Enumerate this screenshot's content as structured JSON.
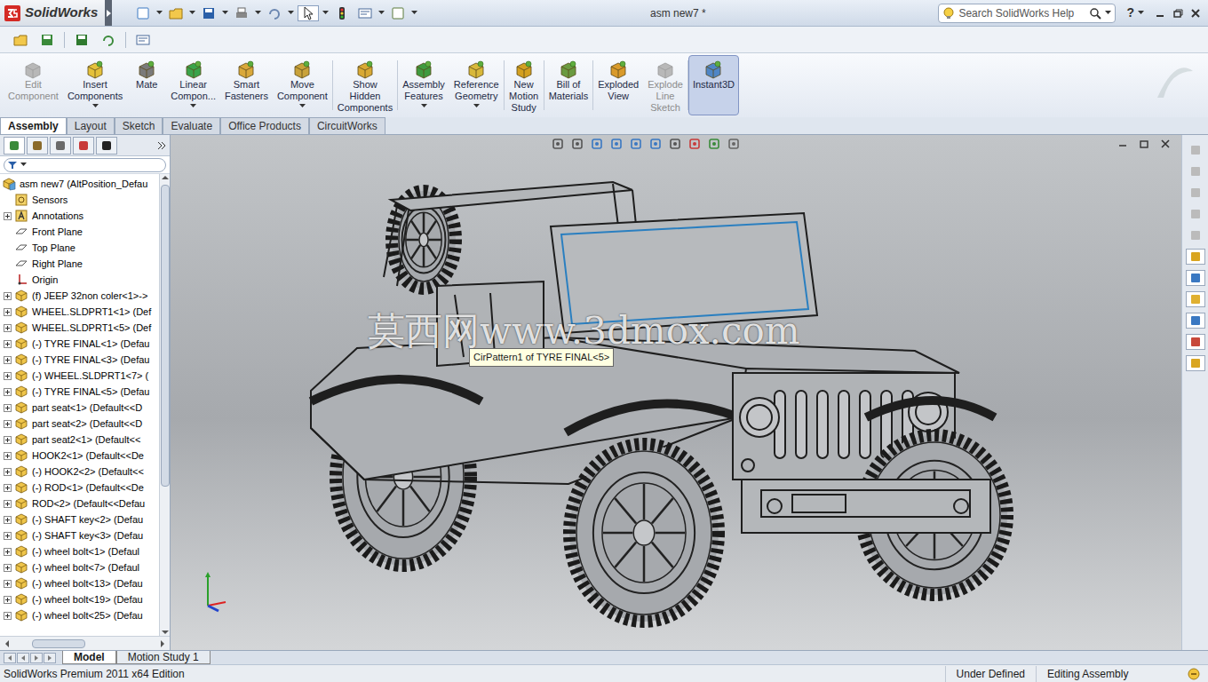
{
  "window": {
    "app_name": "SolidWorks",
    "title": "asm new7 *"
  },
  "search": {
    "placeholder": "Search SolidWorks Help"
  },
  "help": "?",
  "ribbon": [
    {
      "lines": [
        "Edit",
        "Component"
      ],
      "disabled": true,
      "selected": false,
      "dropdown": false,
      "group": 1
    },
    {
      "lines": [
        "Insert",
        "Components"
      ],
      "disabled": false,
      "selected": false,
      "dropdown": true,
      "group": 1
    },
    {
      "lines": [
        "Mate"
      ],
      "disabled": false,
      "selected": false,
      "dropdown": false,
      "group": 1
    },
    {
      "lines": [
        "Linear",
        "Compon..."
      ],
      "disabled": false,
      "selected": false,
      "dropdown": true,
      "group": 1
    },
    {
      "lines": [
        "Smart",
        "Fasteners"
      ],
      "disabled": false,
      "selected": false,
      "dropdown": false,
      "group": 1
    },
    {
      "lines": [
        "Move",
        "Component"
      ],
      "disabled": false,
      "selected": false,
      "dropdown": true,
      "group": 1
    },
    {
      "lines": [
        "Show",
        "Hidden",
        "Components"
      ],
      "disabled": false,
      "selected": false,
      "dropdown": false,
      "group": 2
    },
    {
      "lines": [
        "Assembly",
        "Features"
      ],
      "disabled": false,
      "selected": false,
      "dropdown": true,
      "group": 3
    },
    {
      "lines": [
        "Reference",
        "Geometry"
      ],
      "disabled": false,
      "selected": false,
      "dropdown": true,
      "group": 3
    },
    {
      "lines": [
        "New",
        "Motion",
        "Study"
      ],
      "disabled": false,
      "selected": false,
      "dropdown": false,
      "group": 4
    },
    {
      "lines": [
        "Bill of",
        "Materials"
      ],
      "disabled": false,
      "selected": false,
      "dropdown": false,
      "group": 5
    },
    {
      "lines": [
        "Exploded",
        "View"
      ],
      "disabled": false,
      "selected": false,
      "dropdown": false,
      "group": 6
    },
    {
      "lines": [
        "Explode",
        "Line",
        "Sketch"
      ],
      "disabled": true,
      "selected": false,
      "dropdown": false,
      "group": 6
    },
    {
      "lines": [
        "Instant3D"
      ],
      "disabled": false,
      "selected": true,
      "dropdown": false,
      "group": 7
    }
  ],
  "command_tabs": [
    {
      "label": "Assembly",
      "selected": true
    },
    {
      "label": "Layout",
      "selected": false
    },
    {
      "label": "Sketch",
      "selected": false
    },
    {
      "label": "Evaluate",
      "selected": false
    },
    {
      "label": "Office Products",
      "selected": false
    },
    {
      "label": "CircuitWorks",
      "selected": false
    }
  ],
  "tree": {
    "items": [
      {
        "label": "asm new7  (AltPosition_Defau",
        "kind": "root",
        "expandable": false
      },
      {
        "label": "Sensors",
        "kind": "sensor",
        "expandable": false
      },
      {
        "label": "Annotations",
        "kind": "annotation",
        "expandable": true
      },
      {
        "label": "Front Plane",
        "kind": "plane",
        "expandable": false
      },
      {
        "label": "Top Plane",
        "kind": "plane",
        "expandable": false
      },
      {
        "label": "Right Plane",
        "kind": "plane",
        "expandable": false
      },
      {
        "label": "Origin",
        "kind": "origin",
        "expandable": false
      },
      {
        "label": "(f) JEEP 32non coler<1>->",
        "kind": "part",
        "expandable": true
      },
      {
        "label": "WHEEL.SLDPRT1<1>  (Def",
        "kind": "part",
        "expandable": true
      },
      {
        "label": "WHEEL.SLDPRT1<5>  (Def",
        "kind": "part",
        "expandable": true
      },
      {
        "label": "(-) TYRE FINAL<1>  (Defau",
        "kind": "part",
        "expandable": true
      },
      {
        "label": "(-) TYRE FINAL<3>  (Defau",
        "kind": "part",
        "expandable": true
      },
      {
        "label": "(-) WHEEL.SLDPRT1<7>  (",
        "kind": "part",
        "expandable": true
      },
      {
        "label": "(-) TYRE FINAL<5>  (Defau",
        "kind": "part",
        "expandable": true
      },
      {
        "label": "part seat<1>  (Default<<D",
        "kind": "part",
        "expandable": true
      },
      {
        "label": "part seat<2>  (Default<<D",
        "kind": "part",
        "expandable": true
      },
      {
        "label": "part seat2<1>  (Default<<",
        "kind": "part",
        "expandable": true
      },
      {
        "label": "HOOK2<1>  (Default<<De",
        "kind": "part",
        "expandable": true
      },
      {
        "label": "(-) HOOK2<2>  (Default<<",
        "kind": "part",
        "expandable": true
      },
      {
        "label": "(-) ROD<1>  (Default<<De",
        "kind": "part",
        "expandable": true
      },
      {
        "label": "ROD<2>  (Default<<Defau",
        "kind": "part",
        "expandable": true
      },
      {
        "label": "(-) SHAFT key<2>  (Defau",
        "kind": "part",
        "expandable": true
      },
      {
        "label": "(-) SHAFT key<3>  (Defau",
        "kind": "part",
        "expandable": true
      },
      {
        "label": "(-) wheel bolt<1>  (Defaul",
        "kind": "part",
        "expandable": true
      },
      {
        "label": "(-) wheel bolt<7>  (Defaul",
        "kind": "part",
        "expandable": true
      },
      {
        "label": "(-) wheel bolt<13>  (Defau",
        "kind": "part",
        "expandable": true
      },
      {
        "label": "(-) wheel bolt<19>  (Defau",
        "kind": "part",
        "expandable": true
      },
      {
        "label": "(-) wheel bolt<25>  (Defau",
        "kind": "part",
        "expandable": true
      }
    ]
  },
  "viewport": {
    "watermark": "莫西网www.3dmox.com",
    "tooltip": "CirPattern1 of TYRE FINAL<5>"
  },
  "bottom_tabs": [
    {
      "label": "Model",
      "selected": true
    },
    {
      "label": "Motion Study 1",
      "selected": false
    }
  ],
  "status_bar": {
    "edition": "SolidWorks Premium 2011 x64 Edition",
    "state": "Under Defined",
    "mode": "Editing Assembly"
  }
}
